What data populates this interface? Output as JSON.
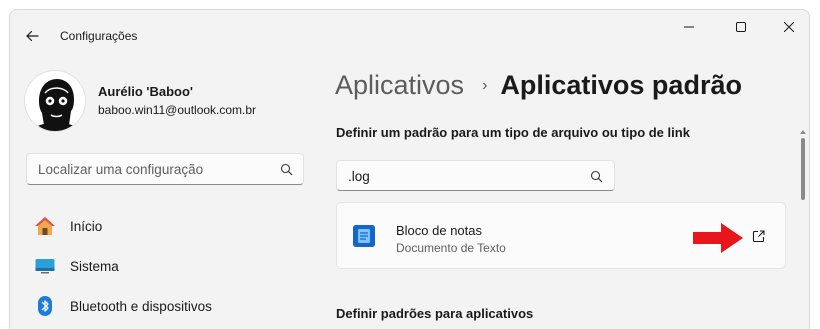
{
  "window": {
    "title": "Configurações"
  },
  "profile": {
    "name": "Aurélio 'Baboo'",
    "email": "baboo.win11@outlook.com.br"
  },
  "sidebar": {
    "search_placeholder": "Localizar uma configuração",
    "items": [
      {
        "label": "Início",
        "icon": "home-icon"
      },
      {
        "label": "Sistema",
        "icon": "system-icon"
      },
      {
        "label": "Bluetooth e dispositivos",
        "icon": "bluetooth-icon"
      }
    ]
  },
  "main": {
    "breadcrumb": {
      "parent": "Aplicativos",
      "separator": "›",
      "current": "Aplicativos padrão"
    },
    "section1_title": "Definir um padrão para um tipo de arquivo ou tipo de link",
    "search_value": ".log",
    "result": {
      "name": "Bloco de notas",
      "description": "Documento de Texto"
    },
    "section2_title": "Definir padrões para aplicativos"
  },
  "colors": {
    "accent": "#0067c0",
    "arrow": "#e8151b",
    "app_icon": "#1467c9"
  }
}
